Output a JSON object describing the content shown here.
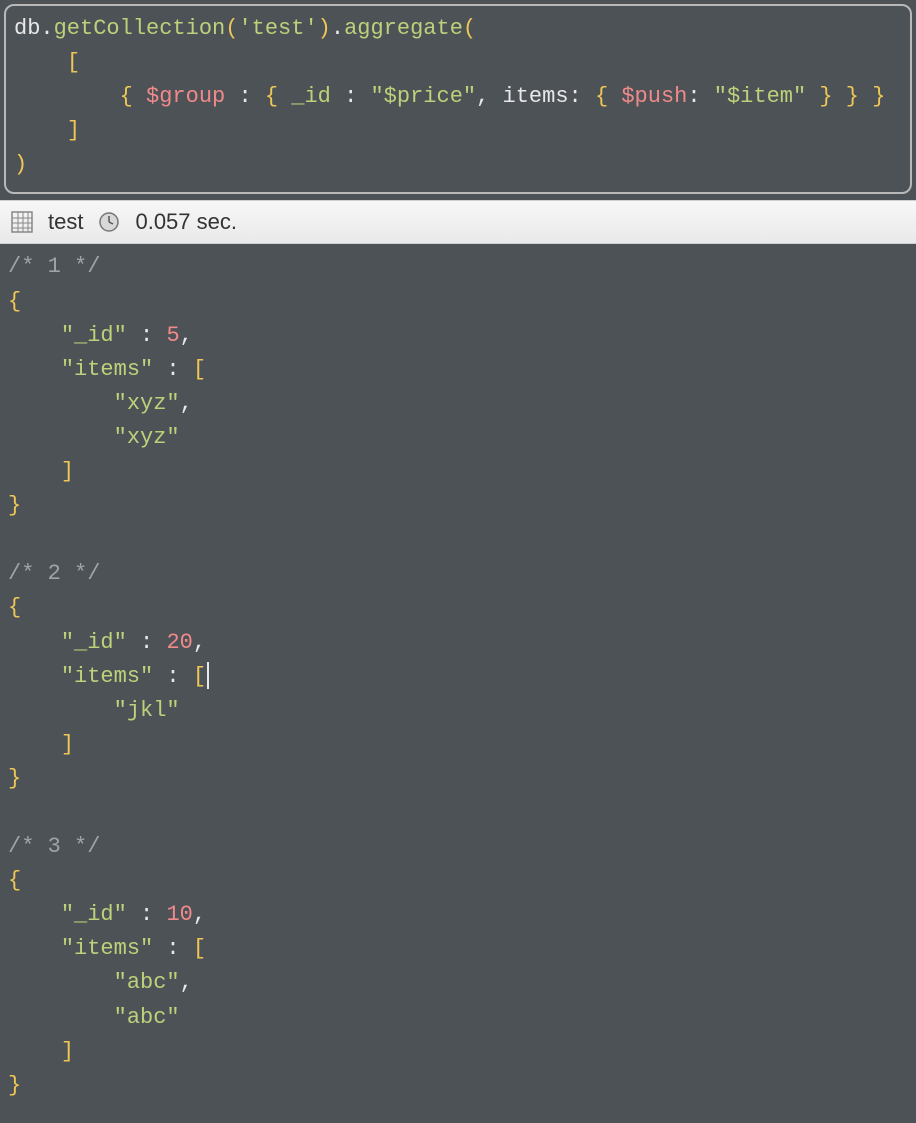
{
  "query": {
    "tokens": [
      {
        "t": "db",
        "c": "tk-default"
      },
      {
        "t": ".",
        "c": "tk-default"
      },
      {
        "t": "getCollection",
        "c": "tk-key"
      },
      {
        "t": "(",
        "c": "tk-bracket"
      },
      {
        "t": "'test'",
        "c": "tk-string"
      },
      {
        "t": ")",
        "c": "tk-bracket"
      },
      {
        "t": ".",
        "c": "tk-default"
      },
      {
        "t": "aggregate",
        "c": "tk-key"
      },
      {
        "t": "(",
        "c": "tk-bracket"
      },
      {
        "t": "\n",
        "c": ""
      },
      {
        "t": "    ",
        "c": ""
      },
      {
        "t": "[",
        "c": "tk-bracket"
      },
      {
        "t": "\n",
        "c": ""
      },
      {
        "t": "        ",
        "c": ""
      },
      {
        "t": "{",
        "c": "tk-bracket"
      },
      {
        "t": " ",
        "c": ""
      },
      {
        "t": "$group",
        "c": "tk-operator"
      },
      {
        "t": " ",
        "c": ""
      },
      {
        "t": ":",
        "c": "tk-default"
      },
      {
        "t": " ",
        "c": ""
      },
      {
        "t": "{",
        "c": "tk-bracket"
      },
      {
        "t": " ",
        "c": ""
      },
      {
        "t": "_id",
        "c": "tk-key"
      },
      {
        "t": " ",
        "c": ""
      },
      {
        "t": ":",
        "c": "tk-default"
      },
      {
        "t": " ",
        "c": ""
      },
      {
        "t": "\"$price\"",
        "c": "tk-string"
      },
      {
        "t": ",",
        "c": "tk-default"
      },
      {
        "t": " ",
        "c": ""
      },
      {
        "t": "items",
        "c": "tk-default"
      },
      {
        "t": ":",
        "c": "tk-default"
      },
      {
        "t": " ",
        "c": ""
      },
      {
        "t": "{",
        "c": "tk-bracket"
      },
      {
        "t": " ",
        "c": ""
      },
      {
        "t": "$push",
        "c": "tk-operator"
      },
      {
        "t": ":",
        "c": "tk-default"
      },
      {
        "t": " ",
        "c": ""
      },
      {
        "t": "\"$item\"",
        "c": "tk-string"
      },
      {
        "t": " ",
        "c": ""
      },
      {
        "t": "}",
        "c": "tk-bracket"
      },
      {
        "t": " ",
        "c": ""
      },
      {
        "t": "}",
        "c": "tk-bracket"
      },
      {
        "t": " ",
        "c": ""
      },
      {
        "t": "}",
        "c": "tk-bracket"
      },
      {
        "t": "\n",
        "c": ""
      },
      {
        "t": "    ",
        "c": ""
      },
      {
        "t": "]",
        "c": "tk-bracket"
      },
      {
        "t": "\n",
        "c": ""
      },
      {
        "t": ")",
        "c": "tk-bracket"
      }
    ]
  },
  "status": {
    "collection": "test",
    "time": "0.057 sec."
  },
  "results": [
    {
      "index": 1,
      "_id": 5,
      "items": [
        "xyz",
        "xyz"
      ],
      "cursor_after_open_bracket": false
    },
    {
      "index": 2,
      "_id": 20,
      "items": [
        "jkl"
      ],
      "cursor_after_open_bracket": true
    },
    {
      "index": 3,
      "_id": 10,
      "items": [
        "abc",
        "abc"
      ],
      "cursor_after_open_bracket": false
    }
  ],
  "labels": {
    "id_key": "\"_id\"",
    "items_key": "\"items\""
  }
}
